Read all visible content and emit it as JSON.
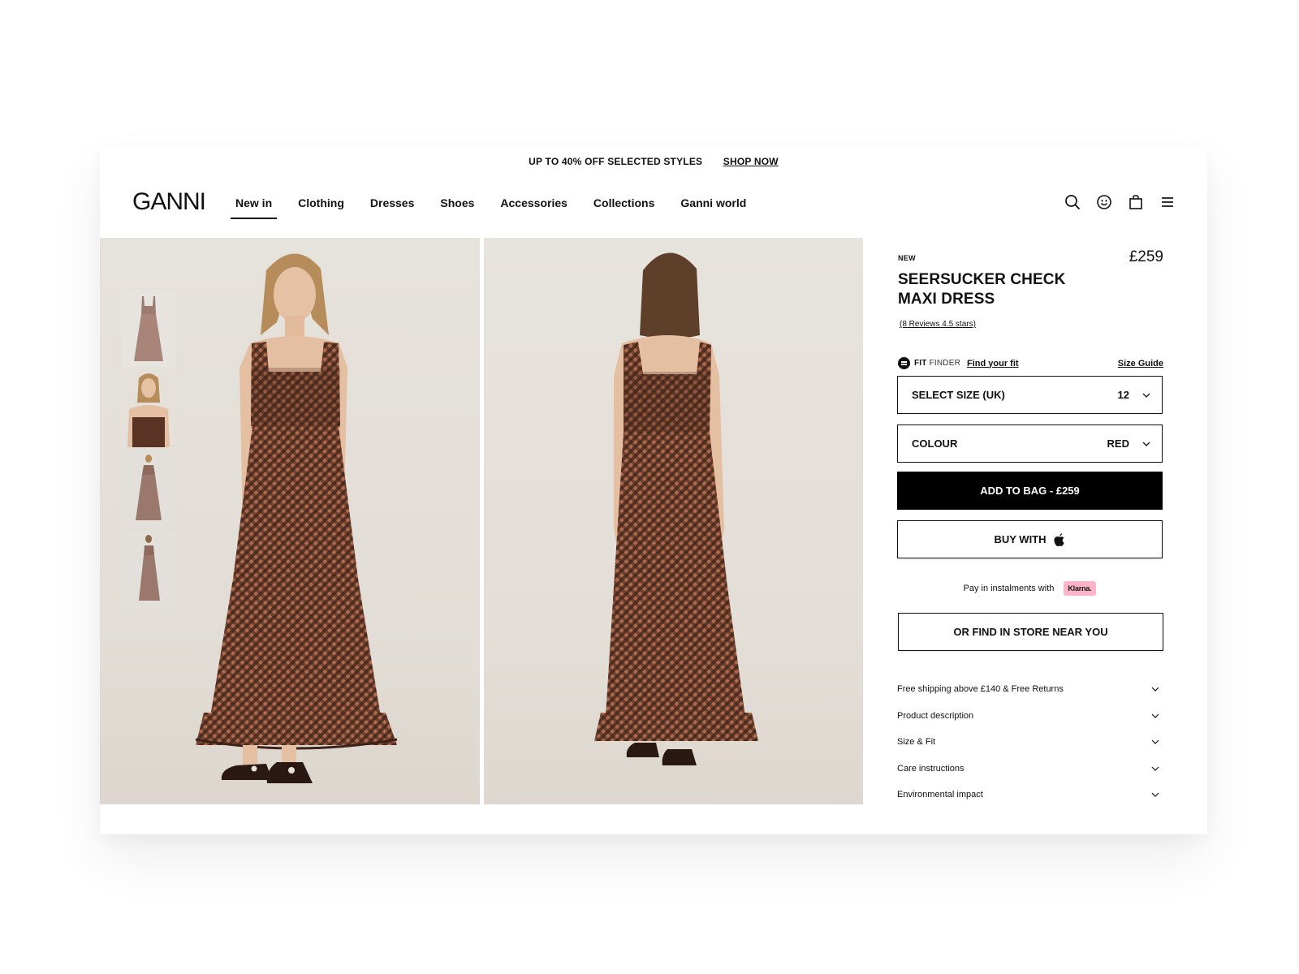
{
  "promo": {
    "text": "UP TO 40% OFF SELECTED STYLES",
    "link": "SHOP NOW"
  },
  "header": {
    "logo": "GANNI",
    "nav": [
      "New in",
      "Clothing",
      "Dresses",
      "Shoes",
      "Accessories",
      "Collections",
      "Ganni world"
    ],
    "active_nav": "New in",
    "icons": [
      "search-icon",
      "account-smiley-icon",
      "shopping-bag-icon",
      "menu-icon"
    ]
  },
  "gallery": {
    "thumbnails": [
      "dress-flat-lay",
      "model-close-up",
      "model-front-full",
      "model-side-full"
    ],
    "images": [
      "model-front",
      "model-back"
    ],
    "dress_colors": {
      "check_dark": "#3e2218",
      "check_light": "#b06a4d",
      "shoe": "#2a1812"
    }
  },
  "product": {
    "tag": "NEW",
    "price": "£259",
    "title": "SEERSUCKER CHECK MAXI DRESS",
    "reviews": "(8 Reviews 4.5 stars)",
    "fit_finder": {
      "brand_bold": "FIT",
      "brand_light": "FINDER",
      "link": "Find your fit"
    },
    "size_guide": "Size Guide",
    "size_select": {
      "label": "SELECT SIZE (UK)",
      "value": "12"
    },
    "colour_select": {
      "label": "COLOUR",
      "value": "RED"
    },
    "add_to_bag": "ADD TO BAG - £259",
    "buy_with": "BUY WITH",
    "klarna": {
      "text": "Pay in instalments with",
      "badge": "Klarna."
    },
    "find_in_store": "OR FIND IN STORE NEAR YOU",
    "accordion": [
      "Free shipping above £140 & Free Returns",
      "Product description",
      "Size & Fit",
      "Care instructions",
      "Environmental impact"
    ]
  }
}
